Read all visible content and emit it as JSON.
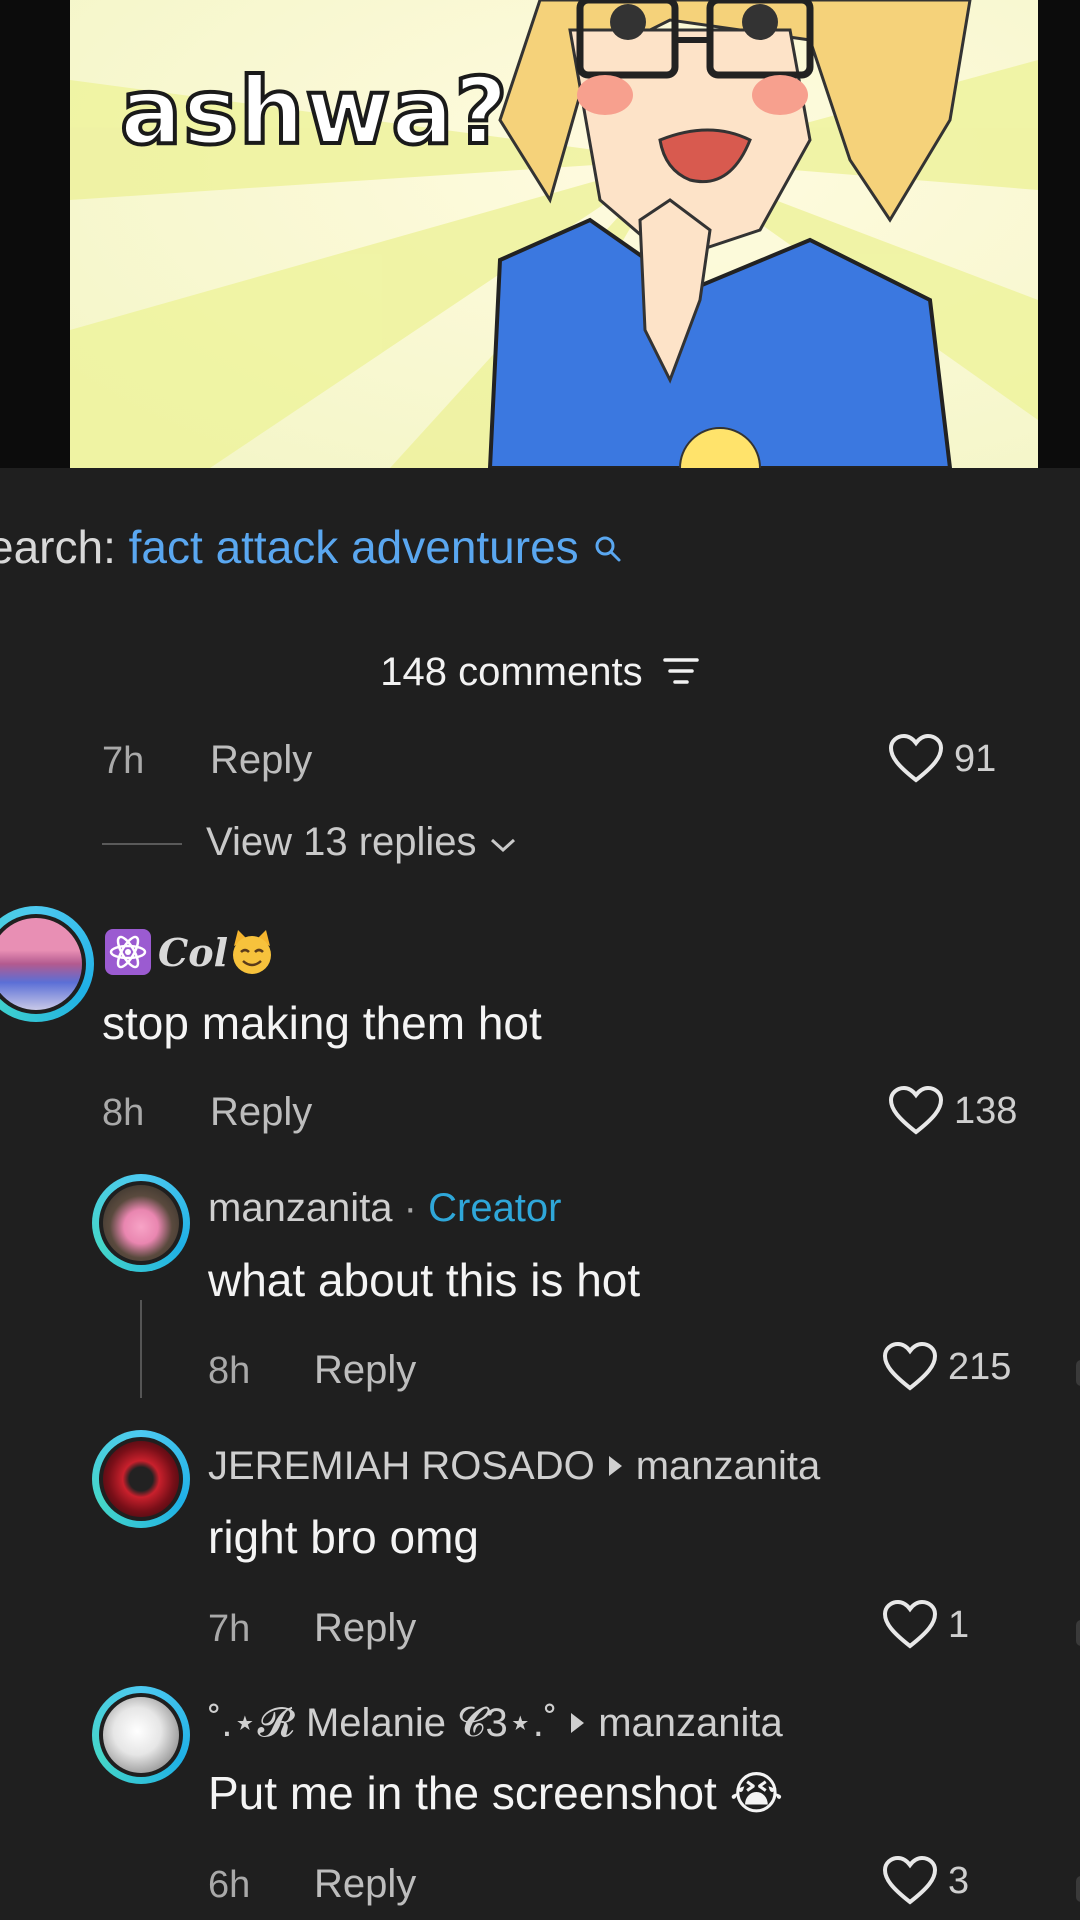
{
  "hero": {
    "caption": "ashwa?"
  },
  "search": {
    "prefix": "earch:",
    "query": "fact attack adventures"
  },
  "comments_header": {
    "label": "148 comments"
  },
  "top_comment": {
    "time": "7h",
    "reply": "Reply",
    "likes": "91"
  },
  "view_replies": {
    "label": "View 13 replies"
  },
  "comments": [
    {
      "name": "Col",
      "body": "stop making them hot",
      "time": "8h",
      "reply": "Reply",
      "likes": "138"
    },
    {
      "name": "manzanita",
      "separator": " · ",
      "badge": "Creator",
      "body": "what about this is hot",
      "time": "8h",
      "reply": "Reply",
      "likes": "215"
    },
    {
      "name": "JEREMIAH ROSADO",
      "reply_to": "manzanita",
      "body": "right bro omg",
      "time": "7h",
      "reply": "Reply",
      "likes": "1"
    },
    {
      "name": "˚.⋆𝓡 Melanie 𝓒3⋆.˚",
      "reply_to": "manzanita",
      "body": "Put me in the screenshot",
      "emoji": "😭",
      "time": "6h",
      "reply": "Reply",
      "likes": "3"
    }
  ],
  "colors": {
    "accent_blue": "#5aa7f0",
    "creator_blue": "#2fa7d9",
    "avatar_ring": "#4dc9f0",
    "background": "#1f1f1f"
  },
  "icons": [
    "search-icon",
    "filter-icon",
    "heart-icon",
    "chevron-down-icon",
    "atom-icon",
    "cat-emoji-icon"
  ]
}
